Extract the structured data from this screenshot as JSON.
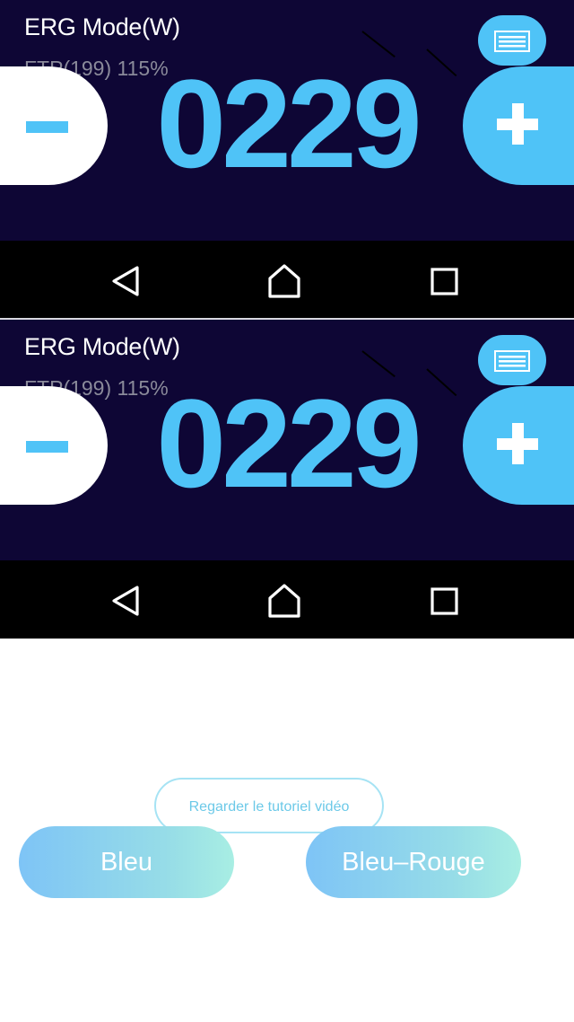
{
  "screens": [
    {
      "mode_title": "ERG Mode(W)",
      "ftp_label": "FTP(199) 115%",
      "power_value": "0229",
      "minus_icon": "minus-icon",
      "plus_icon": "plus-icon",
      "menu_icon": "menu-icon"
    },
    {
      "mode_title": "ERG Mode(W)",
      "ftp_label": "FTP(199) 115%",
      "power_value": "0229",
      "minus_icon": "minus-icon",
      "plus_icon": "plus-icon",
      "menu_icon": "menu-icon"
    }
  ],
  "system_nav": {
    "back_icon": "back-triangle-icon",
    "home_icon": "home-icon",
    "recent_icon": "recent-apps-icon"
  },
  "bottom": {
    "tutorial_label": "Regarder le tutoriel vidéo",
    "option_blue": "Bleu",
    "option_blue_red": "Bleu–Rouge"
  },
  "colors": {
    "app_background": "#0e0635",
    "accent_blue": "#4fc3f7",
    "nav_bar": "#000000"
  }
}
